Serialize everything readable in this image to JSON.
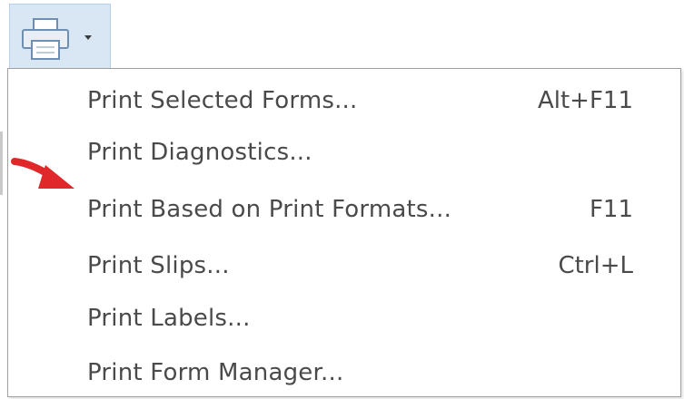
{
  "toolbar": {
    "print_button_icon": "printer-icon",
    "dropdown_icon": "dropdown-arrow-icon"
  },
  "menu": {
    "items": [
      {
        "label": "Print Selected Forms...",
        "shortcut": "Alt+F11"
      },
      {
        "label": "Print Diagnostics...",
        "shortcut": ""
      },
      {
        "label": "Print Based on Print Formats...",
        "shortcut": "F11"
      },
      {
        "label": "Print Slips...",
        "shortcut": "Ctrl+L"
      },
      {
        "label": "Print Labels...",
        "shortcut": ""
      },
      {
        "label": "Print Form Manager...",
        "shortcut": ""
      }
    ]
  },
  "annotation": {
    "arrow_icon": "red-pointer-arrow-icon",
    "color": "#e0282a"
  },
  "colors": {
    "button_bg": "#d9e7f4",
    "menu_text": "#4a4a4a",
    "menu_border": "#a0a0a0"
  }
}
